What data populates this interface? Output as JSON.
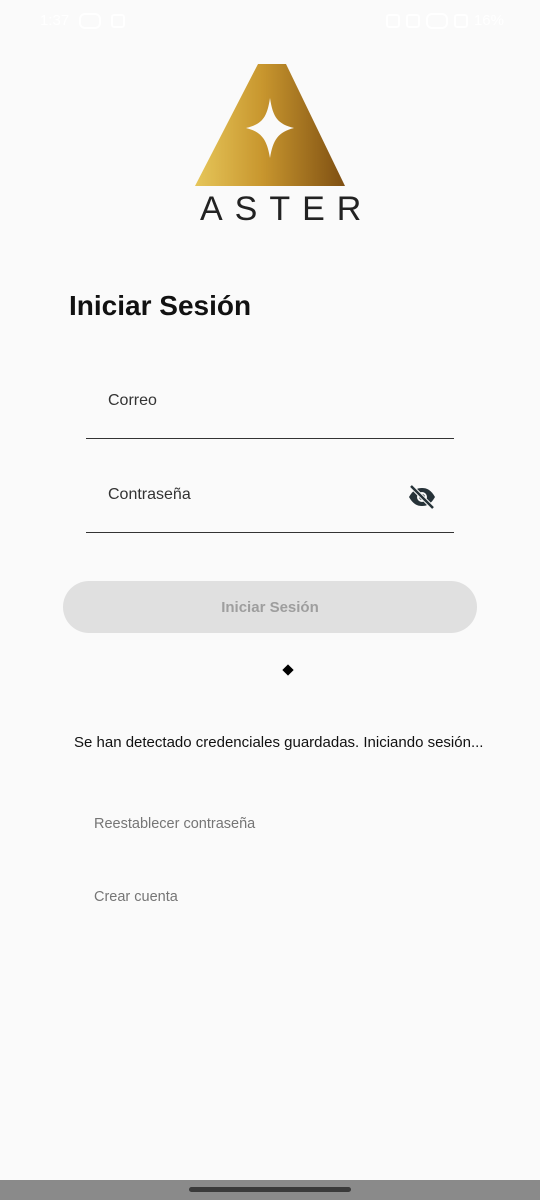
{
  "status_bar": {
    "time": "1:37",
    "battery": "16%"
  },
  "brand": {
    "name": "ASTER",
    "logo_color_light": "#d9b64a",
    "logo_color_dark": "#8a5a14"
  },
  "login": {
    "title": "Iniciar Sesión",
    "email_label": "Correo",
    "password_label": "Contraseña",
    "submit_label": "Iniciar Sesión",
    "status_message": "Se han detectado credenciales guardadas. Iniciando sesión...",
    "reset_password_link": "Reestablecer contraseña",
    "create_account_link": "Crear cuenta"
  }
}
